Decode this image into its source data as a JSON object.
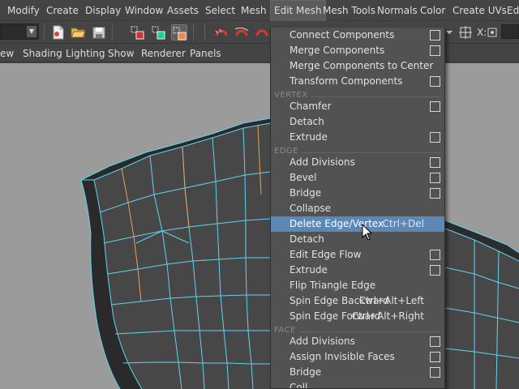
{
  "menubar": {
    "items": [
      "Modify",
      "Create",
      "Display",
      "Window",
      "Assets",
      "Select",
      "Mesh",
      "Edit Mesh",
      "Mesh Tools",
      "Normals",
      "Color",
      "Create UVs",
      "Ed"
    ],
    "active_index": 7
  },
  "toolbar": {
    "coord_label": "X:"
  },
  "panelbar": {
    "items": [
      "ew",
      "Shading",
      "Lighting",
      "Show",
      "Renderer",
      "Panels"
    ]
  },
  "dropdown": {
    "items": [
      {
        "type": "item",
        "label": "Connect Components",
        "option": true
      },
      {
        "type": "item",
        "label": "Merge Components",
        "option": true
      },
      {
        "type": "item",
        "label": "Merge Components to Center",
        "option": false
      },
      {
        "type": "item",
        "label": "Transform Components",
        "option": true
      },
      {
        "type": "section",
        "label": "VERTEX"
      },
      {
        "type": "item",
        "label": "Chamfer",
        "option": true
      },
      {
        "type": "item",
        "label": "Detach",
        "option": false
      },
      {
        "type": "item",
        "label": "Extrude",
        "option": true
      },
      {
        "type": "section",
        "label": "EDGE"
      },
      {
        "type": "item",
        "label": "Add Divisions",
        "option": true
      },
      {
        "type": "item",
        "label": "Bevel",
        "option": true
      },
      {
        "type": "item",
        "label": "Bridge",
        "option": true
      },
      {
        "type": "item",
        "label": "Collapse",
        "option": false
      },
      {
        "type": "item",
        "label": "Delete Edge/Vertex",
        "shortcut": "Ctrl+Del",
        "option": false,
        "highlighted": true
      },
      {
        "type": "item",
        "label": "Detach",
        "option": false
      },
      {
        "type": "item",
        "label": "Edit Edge Flow",
        "option": true
      },
      {
        "type": "item",
        "label": "Extrude",
        "option": true
      },
      {
        "type": "item",
        "label": "Flip Triangle Edge",
        "option": false
      },
      {
        "type": "item",
        "label": "Spin Edge Backward",
        "shortcut": "Ctrl+Alt+Left",
        "option": false
      },
      {
        "type": "item",
        "label": "Spin Edge Forward",
        "shortcut": "Ctrl+Alt+Right",
        "option": false
      },
      {
        "type": "section",
        "label": "FACE"
      },
      {
        "type": "item",
        "label": "Add Divisions",
        "option": true
      },
      {
        "type": "item",
        "label": "Assign Invisible Faces",
        "option": true
      },
      {
        "type": "item",
        "label": "Bridge",
        "option": true
      },
      {
        "type": "item",
        "label": "Coll",
        "option": false
      }
    ]
  },
  "icons": {
    "toolbar": [
      "dropdown-arrow-icon",
      "new-scene-icon",
      "open-folder-icon",
      "save-icon",
      "select-hierarchy-icon",
      "select-object-icon",
      "select-component-icon",
      "magnet-snap-grid-icon",
      "magnet-snap-curve-icon",
      "magnet-snap-point-icon",
      "snap-toggle-icon"
    ],
    "cursor": "arrow-pointer-icon"
  },
  "colors": {
    "highlight": "#5c88b5",
    "menu_bg": "#525252",
    "viewport_bg": "#9b9b9b",
    "mesh_edge": "#5fd4f0",
    "selected_edge": "#e8a05a"
  }
}
